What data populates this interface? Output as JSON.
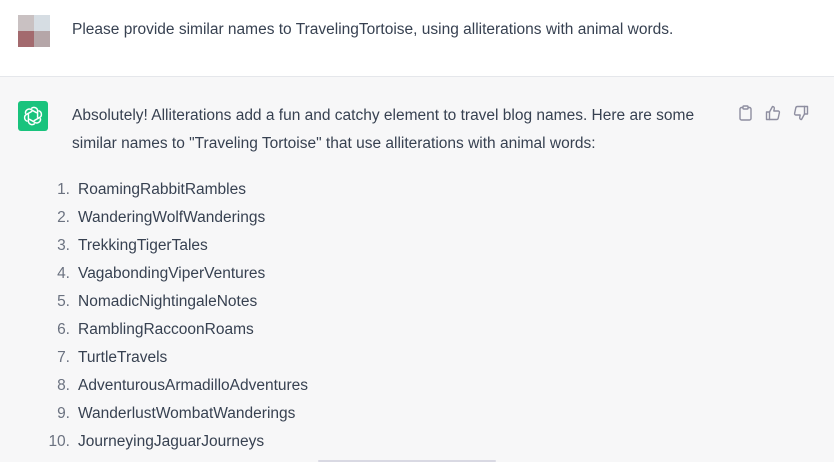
{
  "user_message": {
    "text": "Please provide similar names to TravelingTortoise, using alliterations with animal words.",
    "avatar_colors": [
      "#c9c1c2",
      "#d6dde3",
      "#a36a6e",
      "#b5a6a8"
    ]
  },
  "assistant_message": {
    "intro": "Absolutely! Alliterations add a fun and catchy element to travel blog names. Here are some similar names to \"Traveling Tortoise\" that use alliterations with animal words:",
    "items": [
      {
        "num": "1.",
        "text": "RoamingRabbitRambles"
      },
      {
        "num": "2.",
        "text": "WanderingWolfWanderings"
      },
      {
        "num": "3.",
        "text": "TrekkingTigerTales"
      },
      {
        "num": "4.",
        "text": "VagabondingViperVentures"
      },
      {
        "num": "5.",
        "text": "NomadicNightingaleNotes"
      },
      {
        "num": "6.",
        "text": "RamblingRaccoonRoams"
      },
      {
        "num": "7.",
        "text": "TurtleTravels"
      },
      {
        "num": "8.",
        "text": "AdventurousArmadilloAdventures"
      },
      {
        "num": "9.",
        "text": "WanderlustWombatWanderings"
      },
      {
        "num": "10.",
        "text": "JourneyingJaguarJourneys"
      }
    ],
    "avatar_color": "#19c37d",
    "actions": [
      "clipboard-icon",
      "thumbs-up-icon",
      "thumbs-down-icon"
    ]
  }
}
